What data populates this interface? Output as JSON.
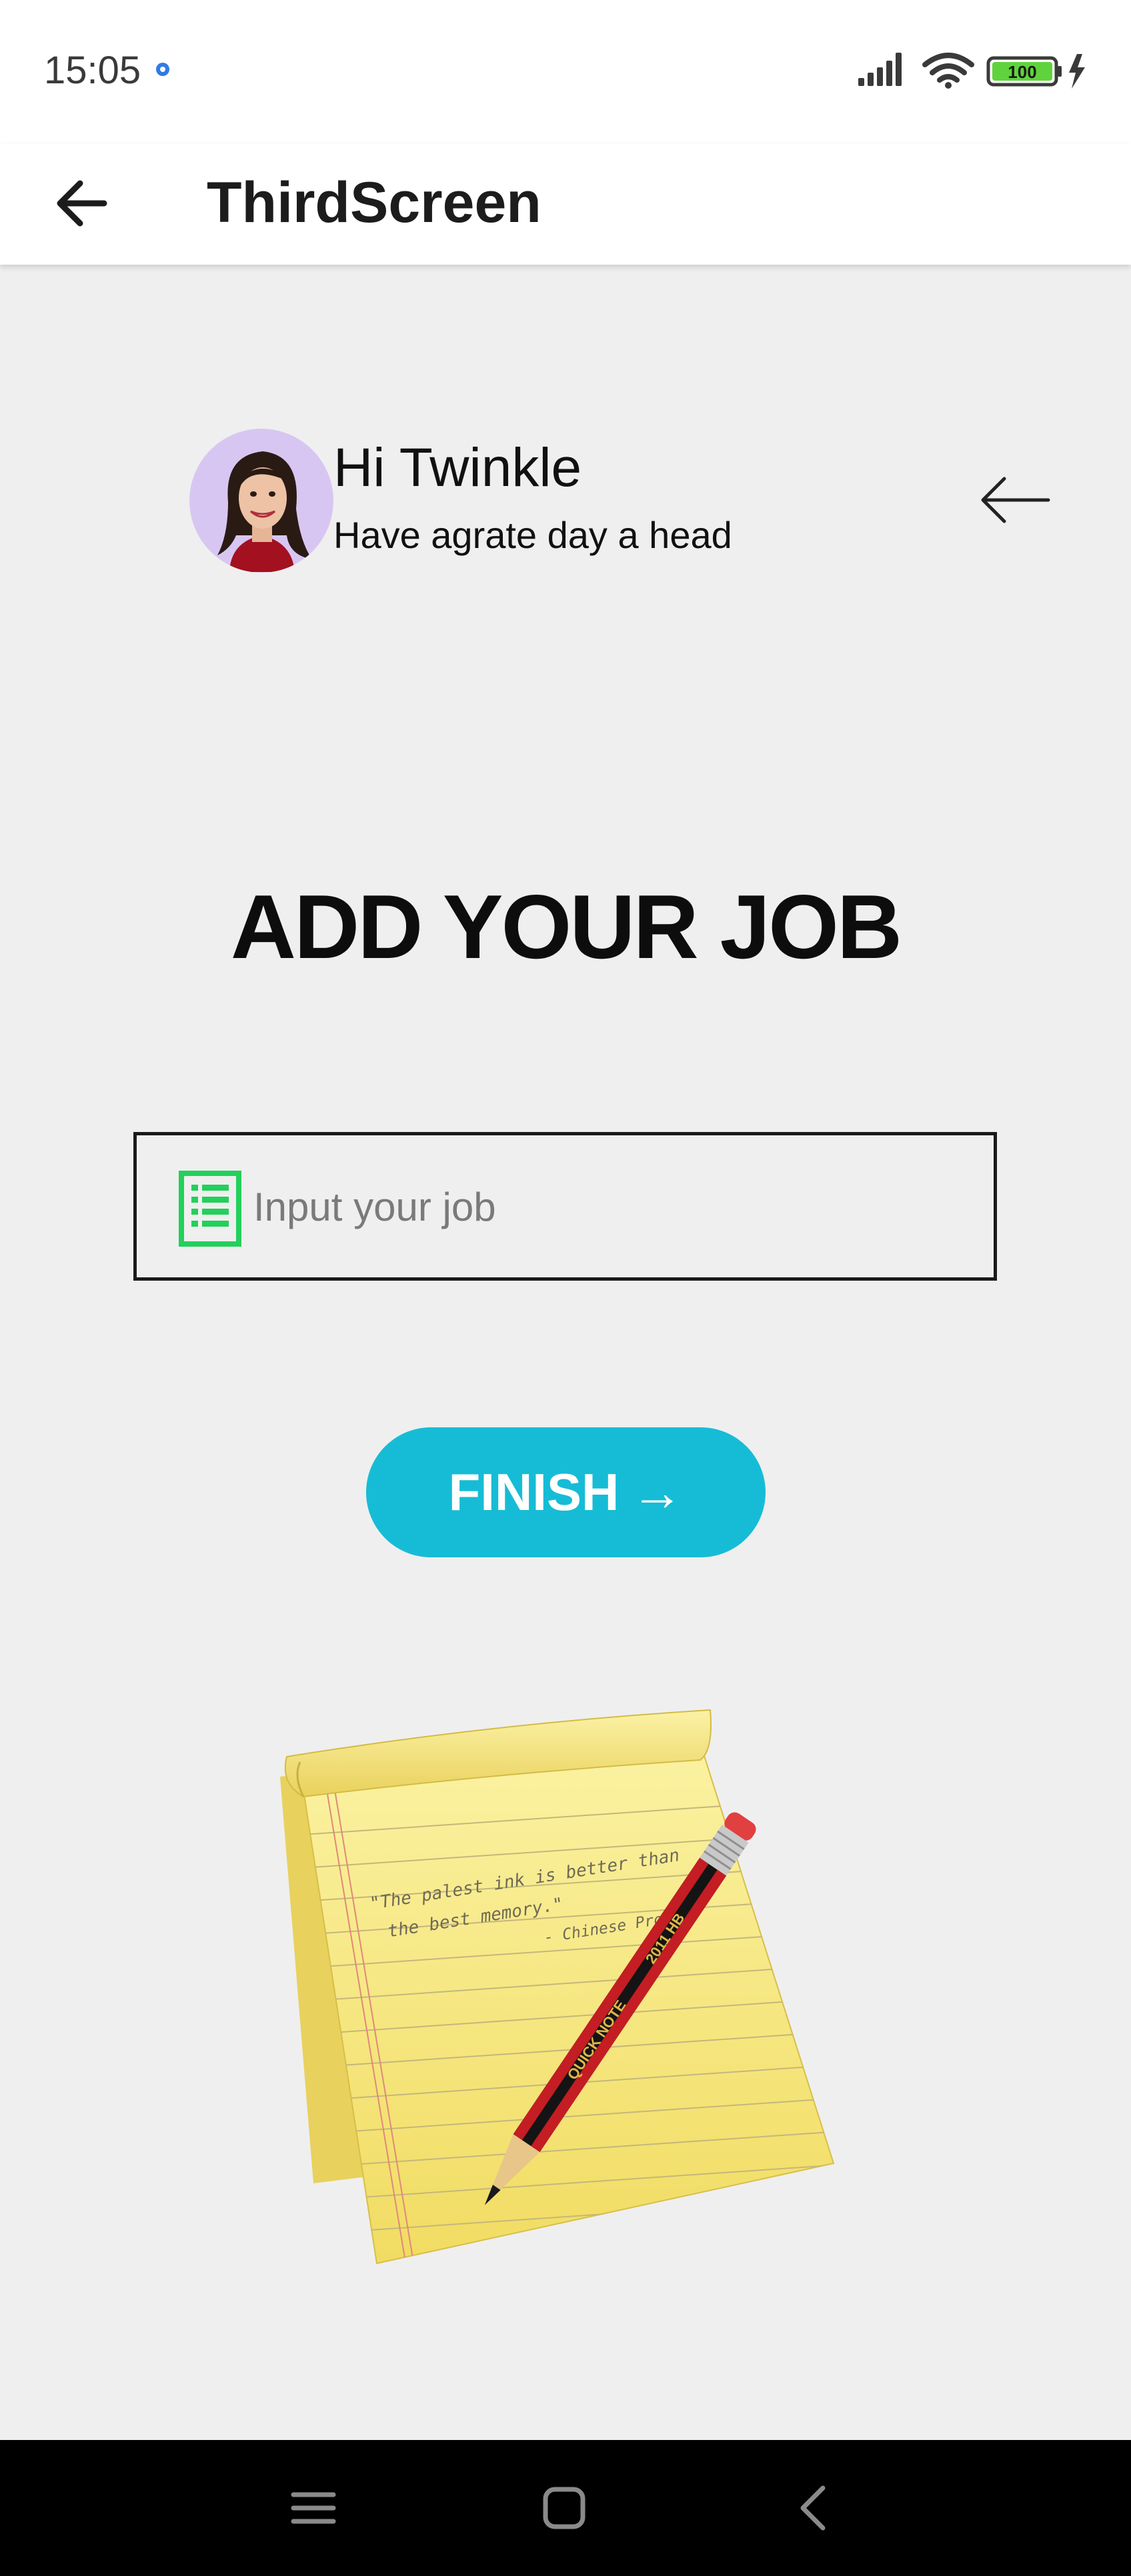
{
  "status_bar": {
    "time": "15:05",
    "battery_level": "100"
  },
  "app_bar": {
    "title": "ThirdScreen"
  },
  "greeting": {
    "name": "Hi Twinkle",
    "subtitle": "Have agrate day a head"
  },
  "main": {
    "heading": "ADD YOUR JOB",
    "job_input": {
      "placeholder": "Input your job",
      "value": ""
    },
    "finish_label": "FINISH",
    "finish_arrow": "→"
  },
  "notepad": {
    "quote_line1": "\"The palest ink is better than",
    "quote_line2": "the best memory.\"",
    "quote_author": "- Chinese Proverb",
    "pencil_text1": "QUICK NOTE",
    "pencil_text2": "2011 HB"
  },
  "colors": {
    "accent": "#16bcd6",
    "background": "#efefef",
    "icon_green": "#22d05a",
    "avatar_bg": "#d8c6f2"
  },
  "icons": {
    "app_back": "arrow-left-icon",
    "greeting_back": "arrow-left-thin-icon",
    "job": "document-list-icon",
    "nav_menu": "menu-icon",
    "nav_home": "home-square-icon",
    "nav_back": "chevron-left-icon"
  }
}
